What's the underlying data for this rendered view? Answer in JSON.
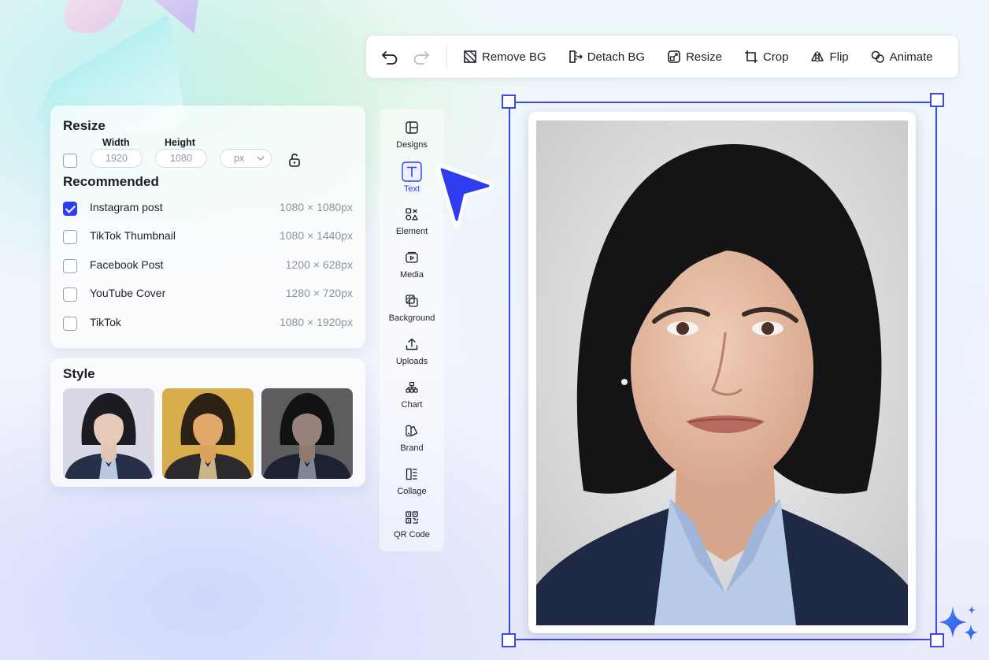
{
  "toolbar": {
    "undo_icon": "undo-icon",
    "redo_icon": "redo-icon",
    "buttons": [
      {
        "label": "Remove BG",
        "icon": "remove-bg-icon"
      },
      {
        "label": "Detach BG",
        "icon": "detach-bg-icon"
      },
      {
        "label": "Resize",
        "icon": "resize-icon"
      },
      {
        "label": "Crop",
        "icon": "crop-icon"
      },
      {
        "label": "Flip",
        "icon": "flip-icon"
      },
      {
        "label": "Animate",
        "icon": "animate-icon"
      }
    ]
  },
  "resize": {
    "title": "Resize",
    "width_label": "Width",
    "height_label": "Height",
    "width_placeholder": "1920",
    "height_placeholder": "1080",
    "unit": "px",
    "custom_checked": false,
    "recommended_title": "Recommended",
    "recommended": [
      {
        "name": "Instagram post",
        "size": "1080 × 1080px",
        "checked": true
      },
      {
        "name": "TikTok Thumbnail",
        "size": "1080 × 1440px",
        "checked": false
      },
      {
        "name": "Facebook Post",
        "size": "1200 × 628px",
        "checked": false
      },
      {
        "name": "YouTube Cover",
        "size": "1280 × 720px",
        "checked": false
      },
      {
        "name": "TikTok",
        "size": "1080 × 1920px",
        "checked": false
      }
    ]
  },
  "style": {
    "title": "Style",
    "filters": [
      "lavender",
      "golden",
      "dark"
    ]
  },
  "sidenav": {
    "active": "Text",
    "items": [
      {
        "label": "Designs",
        "icon": "designs-icon"
      },
      {
        "label": "Text",
        "icon": "text-icon"
      },
      {
        "label": "Element",
        "icon": "element-icon"
      },
      {
        "label": "Media",
        "icon": "media-icon"
      },
      {
        "label": "Background",
        "icon": "background-icon"
      },
      {
        "label": "Uploads",
        "icon": "uploads-icon"
      },
      {
        "label": "Chart",
        "icon": "chart-icon"
      },
      {
        "label": "Brand",
        "icon": "brand-icon"
      },
      {
        "label": "Collage",
        "icon": "collage-icon"
      },
      {
        "label": "QR Code",
        "icon": "qr-code-icon"
      }
    ]
  },
  "colors": {
    "accent": "#2f3cf0",
    "selection": "#3d48e8",
    "sparkle": "#3b6ef0"
  }
}
